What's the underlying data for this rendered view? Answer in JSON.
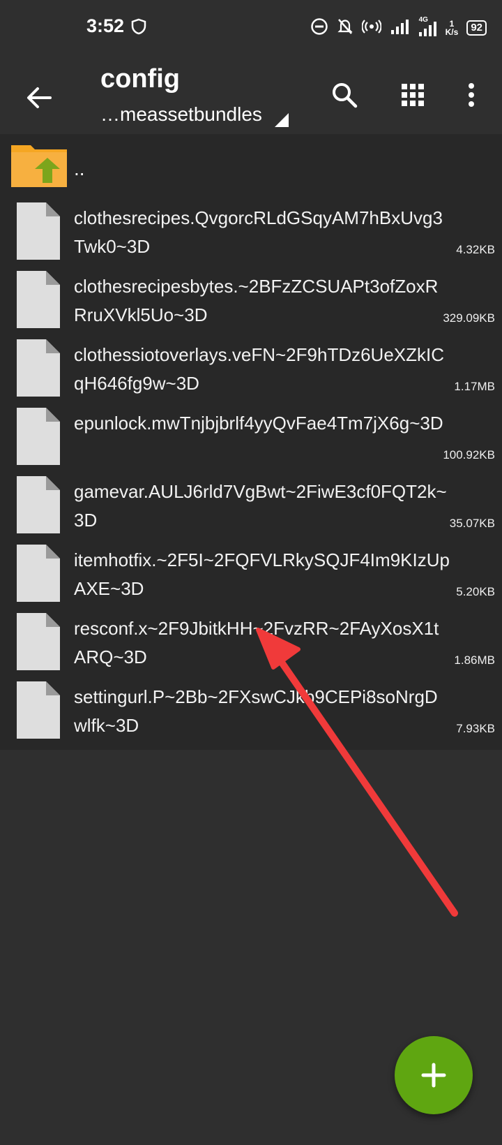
{
  "status_bar": {
    "time": "3:52",
    "net_speed_value": "1",
    "net_speed_unit": "K/s",
    "battery": "92",
    "network_type": "4G"
  },
  "toolbar": {
    "title": "config",
    "subtitle": "…meassetbundles"
  },
  "parent_folder": {
    "label": ".."
  },
  "files": [
    {
      "name": "clothesrecipes.QvgorcRLdGSqyAM7hBxUvg3Twk0~3D",
      "size": "4.32KB"
    },
    {
      "name": "clothesrecipesbytes.~2BFzZCSUAPt3ofZoxRRruXVkl5Uo~3D",
      "size": "329.09KB"
    },
    {
      "name": "clothessiotoverlays.veFN~2F9hTDz6UeXZkICqH646fg9w~3D",
      "size": "1.17MB"
    },
    {
      "name": "epunlock.mwTnjbjbrlf4yyQvFae4Tm7jX6g~3D",
      "size": "100.92KB"
    },
    {
      "name": "gamevar.AULJ6rld7VgBwt~2FiwE3cf0FQT2k~3D",
      "size": "35.07KB"
    },
    {
      "name": "itemhotfix.~2F5I~2FQFVLRkySQJF4Im9KIzUpAXE~3D",
      "size": "5.20KB"
    },
    {
      "name": "resconf.x~2F9JbitkHH~2FvzRR~2FAyXosX1tARQ~3D",
      "size": "1.86MB"
    },
    {
      "name": "settingurl.P~2Bb~2FXswCJkb9CEPi8soNrgDwlfk~3D",
      "size": "7.93KB"
    }
  ],
  "colors": {
    "background": "#2f2f2f",
    "list_background": "#282828",
    "fab": "#5fa611",
    "annotation_arrow": "#f03a3a",
    "folder": "#f5a623",
    "folder_arrow": "#7ca51c"
  },
  "icons": {
    "back": "arrow-left-icon",
    "search": "search-icon",
    "grid": "grid-view-icon",
    "more": "more-vertical-icon",
    "fab": "plus-icon"
  }
}
